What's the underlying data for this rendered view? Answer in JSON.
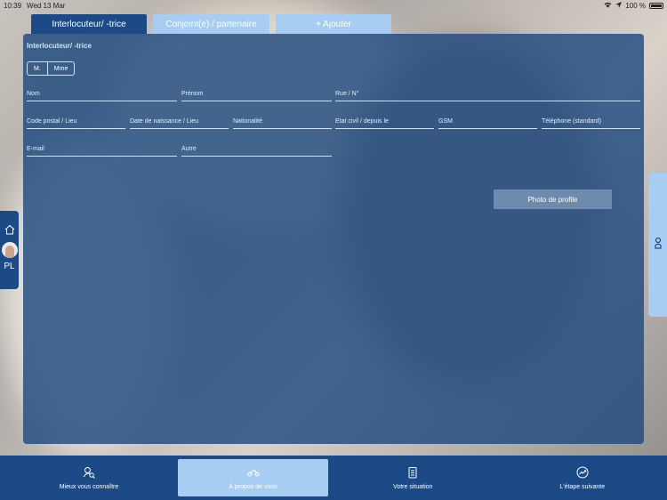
{
  "status": {
    "time": "10:39",
    "date": "Wed 13 Mar",
    "battery": "100 %"
  },
  "tabs": [
    {
      "label": "Interlocuteur/ -trice"
    },
    {
      "label": "Conjoint(e) / partenaire"
    },
    {
      "label": "+ Ajouter"
    }
  ],
  "form": {
    "section_title": "Interlocuteur/ -trice",
    "gender_options": [
      "M.",
      "Mme"
    ],
    "fields": {
      "nom": "Nom",
      "prenom": "Prénom",
      "rue": "Rue / N°",
      "code_postal": "Code postal / Lieu",
      "date_naissance": "Date de naissance / Lieu",
      "nationalite": "Nationalité",
      "etat_civil": "Etat civil / depuis le",
      "gsm": "GSM",
      "telephone": "Téléphone (standard)",
      "email": "E-mail",
      "autre": "Autre"
    },
    "photo_button": "Photo de profile"
  },
  "left_rail": {
    "initials": "PL"
  },
  "bottom_nav": [
    {
      "label": "Mieux vous connaître",
      "icon": "search-person-icon"
    },
    {
      "label": "À propos de vous",
      "icon": "scooter-icon"
    },
    {
      "label": "Votre situation",
      "icon": "clipboard-icon"
    },
    {
      "label": "L'étape suivante",
      "icon": "trend-icon"
    }
  ],
  "colors": {
    "primary": "#1c4a86",
    "accent_light": "#a7cdf2",
    "button": "#6d8bad"
  }
}
